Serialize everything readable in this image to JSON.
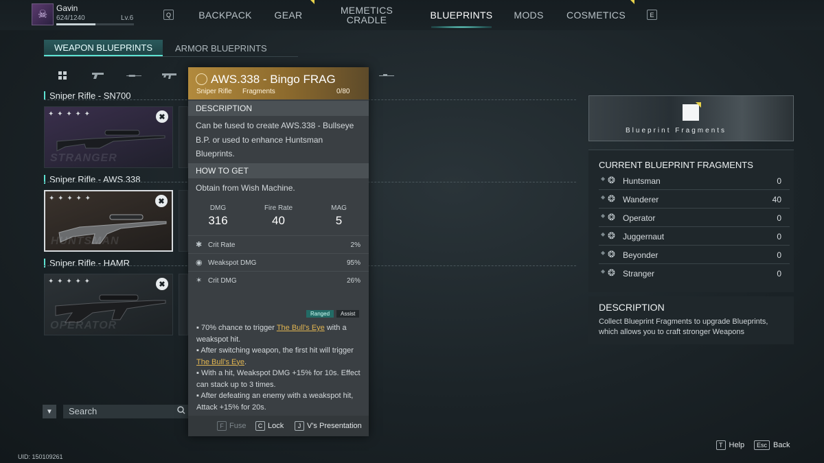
{
  "player": {
    "name": "Gavin",
    "xp": "624/1240",
    "xp_fraction": 0.503,
    "level": "Lv.6"
  },
  "nav": {
    "left_key": "Q",
    "right_key": "E",
    "items": [
      {
        "label": "BACKPACK"
      },
      {
        "label": "GEAR"
      },
      {
        "label": "MEMETICS CRADLE"
      },
      {
        "label": "BLUEPRINTS",
        "active": true
      },
      {
        "label": "MODS"
      },
      {
        "label": "COSMETICS"
      }
    ]
  },
  "subtabs": {
    "weapon": "WEAPON BLUEPRINTS",
    "armor": "ARMOR BLUEPRINTS"
  },
  "filter_icons": [
    "grid-icon",
    "pistol-icon",
    "rifle-icon",
    "smg-icon",
    "sniper-icon"
  ],
  "groups": [
    {
      "title": "Sniper Rifle - SN700",
      "card_watermark": "STRANGER"
    },
    {
      "title": "Sniper Rifle - AWS.338",
      "card_watermark": "HUNTSMAN"
    },
    {
      "title": "Sniper Rifle - HAMR",
      "card_watermark": "OPERATOR"
    }
  ],
  "card_stars": "✦ ✦ ✦ ✦ ✦",
  "search": {
    "placeholder": "Search"
  },
  "tooltip": {
    "title": "AWS.338 - Bingo FRAG",
    "type": "Sniper Rifle",
    "category": "Fragments",
    "count": "0/80",
    "description_header": "DESCRIPTION",
    "description": "Can be fused to create AWS.338 - Bullseye B.P. or used to enhance Huntsman Blueprints.",
    "howto_header": "HOW TO GET",
    "howto": "Obtain from Wish Machine.",
    "stats": [
      {
        "label": "DMG",
        "value": "316"
      },
      {
        "label": "Fire Rate",
        "value": "40"
      },
      {
        "label": "MAG",
        "value": "5"
      }
    ],
    "substats": [
      {
        "label": "Crit Rate",
        "value": "2%"
      },
      {
        "label": "Weakspot DMG",
        "value": "95%"
      },
      {
        "label": "Crit DMG",
        "value": "26%"
      }
    ],
    "tags": {
      "ranged": "Ranged",
      "assist": "Assist"
    },
    "effects": {
      "e1_pre": "▪ 70% chance to trigger ",
      "e1_link": "The Bull's Eye",
      "e1_post": " with a weakspot hit.",
      "e2_pre": "▪ After switching weapon, the first hit will trigger ",
      "e2_link": "The Bull's Eye",
      "e2_post": ".",
      "e3": "▪ With a hit, Weakspot DMG +15% for 10s. Effect can stack up to 3 times.",
      "e4": "▪ After defeating an enemy with a weakspot hit, Attack +15% for 20s."
    },
    "footer": {
      "fuse_key": "F",
      "fuse": "Fuse",
      "lock_key": "C",
      "lock": "Lock",
      "pres_key": "J",
      "pres": "V's Presentation"
    }
  },
  "banner": {
    "label": "Blueprint Fragments"
  },
  "fragments": {
    "title": "CURRENT BLUEPRINT FRAGMENTS",
    "items": [
      {
        "name": "Huntsman",
        "value": "0"
      },
      {
        "name": "Wanderer",
        "value": "40"
      },
      {
        "name": "Operator",
        "value": "0"
      },
      {
        "name": "Juggernaut",
        "value": "0"
      },
      {
        "name": "Beyonder",
        "value": "0"
      },
      {
        "name": "Stranger",
        "value": "0"
      }
    ]
  },
  "right_description": {
    "title": "DESCRIPTION",
    "text": "Collect Blueprint Fragments to upgrade Blueprints, which allows you to craft stronger Weapons"
  },
  "footer": {
    "uid": "UID: 150109261",
    "help_key": "T",
    "help": "Help",
    "back_key": "Esc",
    "back": "Back"
  },
  "colors": {
    "accent": "#5ee3d2",
    "gold_header": "#b28a3d",
    "link": "#e1b552"
  }
}
